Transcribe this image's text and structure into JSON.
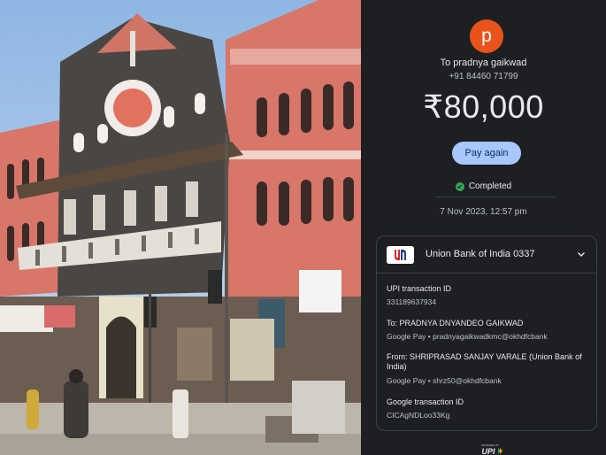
{
  "recipient": {
    "avatar_letter": "p",
    "avatar_color": "#e8531c",
    "to_line": "To pradnya gaikwad",
    "phone": "+91 84460 71799"
  },
  "amount": "₹80,000",
  "pay_again_label": "Pay again",
  "status": {
    "label": "Completed",
    "color": "#34a853",
    "icon": "check-circle-icon"
  },
  "datetime": "7 Nov 2023, 12:57 pm",
  "bank": {
    "name": "Union Bank of India 0337",
    "logo": "union-bank-logo",
    "chevron": "chevron-down-icon"
  },
  "details": {
    "upi_label": "UPI transaction ID",
    "upi_id": "331189637934",
    "to_label": "To: PRADNYA DNYANDEO GAIKWAD",
    "to_sub": "Google Pay • pradnyagaikwadkmc@okhdfcbank",
    "from_label": "From: SHRIPRASAD SANJAY VARALE (Union Bank of India)",
    "from_sub": "Google Pay • shrz50@okhdfcbank",
    "gtid_label": "Google transaction ID",
    "gtid": "CICAgNDLoo33Kg"
  },
  "footer": {
    "powered_by": "POWERED BY",
    "brand": "UPI"
  },
  "colors": {
    "panel_bg": "#1e1f23",
    "pay_again_bg": "#a8c7fa"
  }
}
